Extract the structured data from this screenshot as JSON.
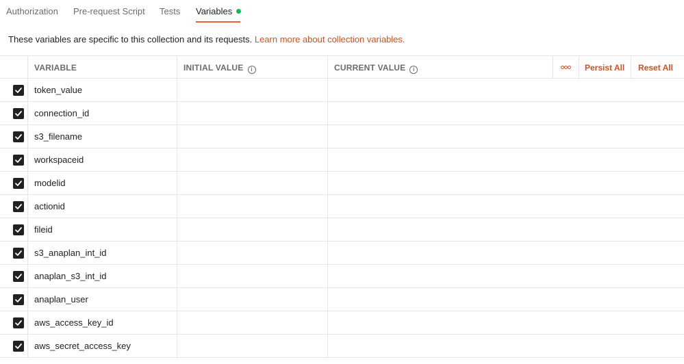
{
  "tabs": [
    {
      "label": "Authorization"
    },
    {
      "label": "Pre-request Script"
    },
    {
      "label": "Tests"
    },
    {
      "label": "Variables"
    }
  ],
  "active_tab_dot_color": "#0cbb52",
  "accent_color": "#d4501e",
  "description": {
    "text": "These variables are specific to this collection and its requests. ",
    "link": "Learn more about collection variables."
  },
  "table": {
    "headers": {
      "variable": "VARIABLE",
      "initial_value": "INITIAL VALUE",
      "current_value": "CURRENT VALUE"
    },
    "actions": {
      "more_icon": "more-horizontal-icon",
      "persist_all": "Persist All",
      "reset_all": "Reset All"
    },
    "rows": [
      {
        "enabled": true,
        "variable": "token_value",
        "initial_value": "",
        "current_value": ""
      },
      {
        "enabled": true,
        "variable": "connection_id",
        "initial_value": "",
        "current_value": ""
      },
      {
        "enabled": true,
        "variable": "s3_filename",
        "initial_value": "",
        "current_value": ""
      },
      {
        "enabled": true,
        "variable": "workspaceid",
        "initial_value": "",
        "current_value": ""
      },
      {
        "enabled": true,
        "variable": "modelid",
        "initial_value": "",
        "current_value": ""
      },
      {
        "enabled": true,
        "variable": "actionid",
        "initial_value": "",
        "current_value": ""
      },
      {
        "enabled": true,
        "variable": "fileid",
        "initial_value": "",
        "current_value": ""
      },
      {
        "enabled": true,
        "variable": "s3_anaplan_int_id",
        "initial_value": "",
        "current_value": ""
      },
      {
        "enabled": true,
        "variable": "anaplan_s3_int_id",
        "initial_value": "",
        "current_value": ""
      },
      {
        "enabled": true,
        "variable": "anaplan_user",
        "initial_value": "",
        "current_value": ""
      },
      {
        "enabled": true,
        "variable": "aws_access_key_id",
        "initial_value": "",
        "current_value": ""
      },
      {
        "enabled": true,
        "variable": "aws_secret_access_key",
        "initial_value": "",
        "current_value": ""
      }
    ]
  }
}
